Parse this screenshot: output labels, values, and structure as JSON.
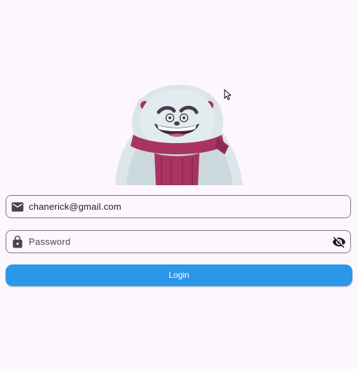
{
  "login_form": {
    "email_value": "chanerick@gmail.com",
    "password_placeholder": "Password",
    "login_label": "Login"
  },
  "icons": {
    "email": "mail-icon",
    "password": "lock-icon",
    "visibility": "eye-off-icon",
    "cursor": "mouse-pointer-icon",
    "mascot": "yeti-mascot-illustration"
  },
  "colors": {
    "background": "#fdf7fd",
    "primary_button": "#2b97e9",
    "field_border": "#79747e",
    "scarf": "#a8345f"
  }
}
